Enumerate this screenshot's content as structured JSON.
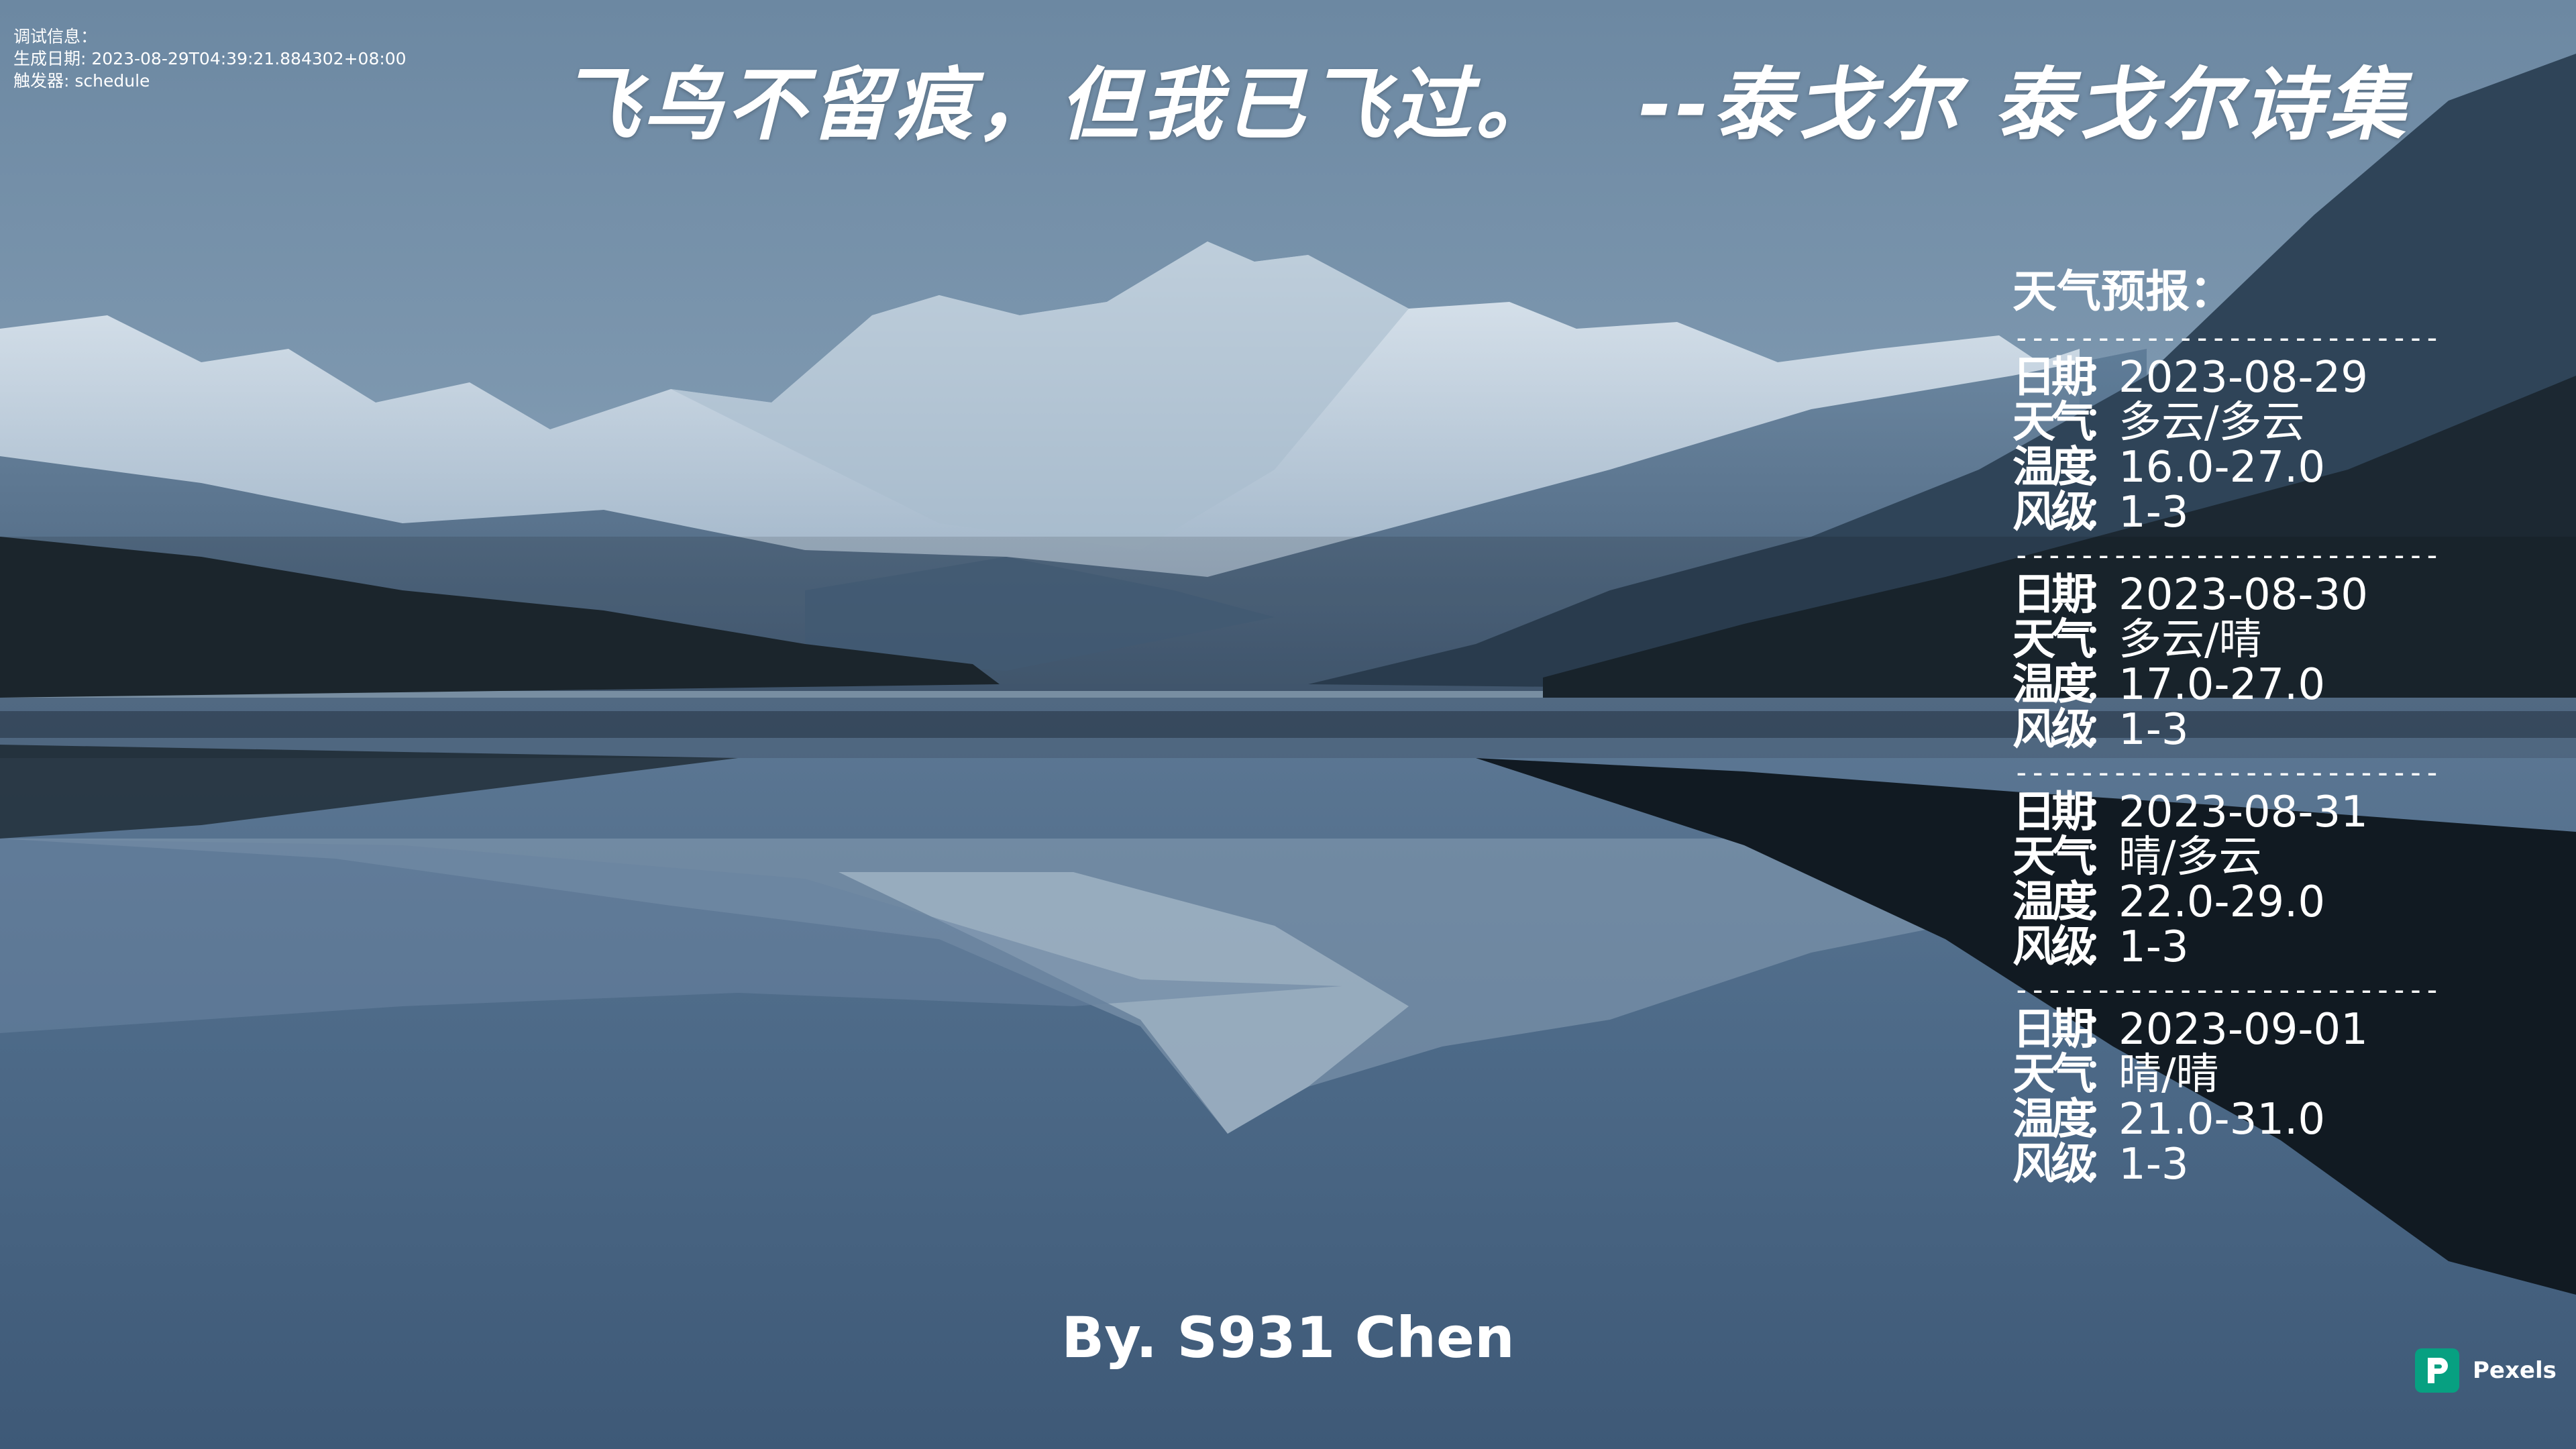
{
  "debug": {
    "line1": "调试信息：",
    "line2": "生成日期: 2023-08-29T04:39:21.884302+08:00",
    "line3": "触发器: schedule"
  },
  "quote": {
    "text": "飞鸟不留痕，但我已飞过。",
    "author": "--泰戈尔 泰戈尔诗集"
  },
  "weather": {
    "title": "天气预报：",
    "divider": "------------------------------",
    "labels": {
      "date": "日期",
      "weather": "天气",
      "temp": "温度",
      "wind": "风级",
      "sep": "："
    },
    "days": [
      {
        "date": "2023-08-29",
        "weather": "多云/多云",
        "temp": "16.0-27.0",
        "wind": "1-3"
      },
      {
        "date": "2023-08-30",
        "weather": "多云/晴",
        "temp": "17.0-27.0",
        "wind": "1-3"
      },
      {
        "date": "2023-08-31",
        "weather": "晴/多云",
        "temp": "22.0-29.0",
        "wind": "1-3"
      },
      {
        "date": "2023-09-01",
        "weather": "晴/晴",
        "temp": "21.0-31.0",
        "wind": "1-3"
      }
    ]
  },
  "byline": "By. S931 Chen",
  "watermark": {
    "name": "Pexels",
    "icon": "pexels-logo-icon",
    "color": "#07a081"
  }
}
